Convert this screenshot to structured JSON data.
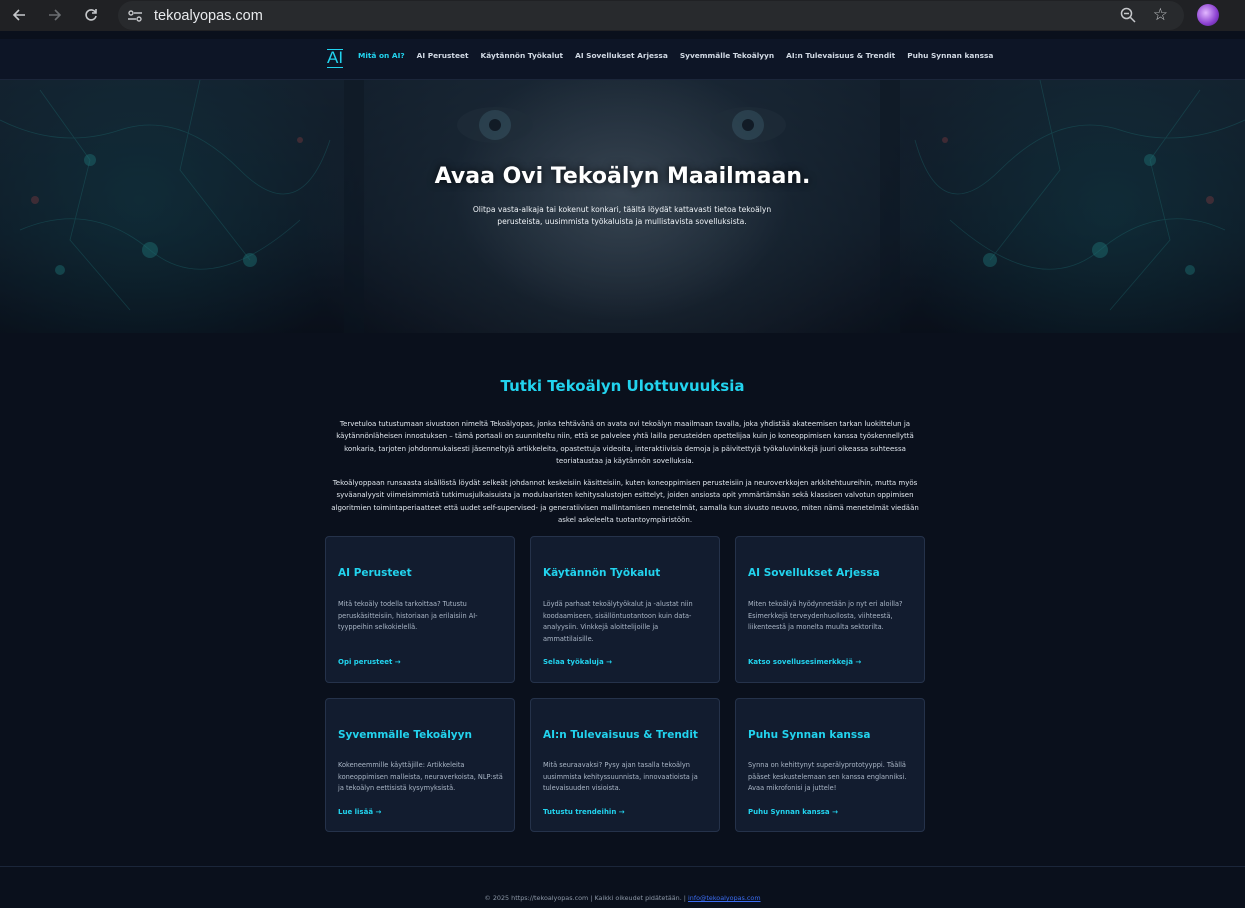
{
  "browser": {
    "url": "tekoalyopas.com"
  },
  "nav": {
    "logo": "AI",
    "links": [
      {
        "label": "Mitä on AI?",
        "active": true
      },
      {
        "label": "AI Perusteet"
      },
      {
        "label": "Käytännön Työkalut"
      },
      {
        "label": "AI Sovellukset Arjessa"
      },
      {
        "label": "Syvemmälle Tekoälyyn"
      },
      {
        "label": "AI:n Tulevaisuus & Trendit"
      },
      {
        "label": "Puhu Synnan kanssa"
      }
    ]
  },
  "hero": {
    "title": "Avaa Ovi Tekoälyn Maailmaan.",
    "subtitle": "Olitpa vasta-alkaja tai kokenut konkari, täältä löydät kattavasti tietoa tekoälyn perusteista, uusimmista työkaluista ja mullistavista sovelluksista."
  },
  "main": {
    "title": "Tutki Tekoälyn Ulottuvuuksia",
    "intro_1": "Tervetuloa tutustumaan sivustoon nimeltä Tekoälyopas, jonka tehtävänä on avata ovi tekoälyn maailmaan tavalla, joka yhdistää akateemisen tarkan luokittelun ja käytännönläheisen innostuksen – tämä portaali on suunniteltu niin, että se palvelee yhtä lailla perusteiden opettelijaa kuin jo koneoppimisen kanssa työskennellyttä konkaria, tarjoten johdonmukaisesti jäsenneltyjä artikkeleita, opastettuja videoita, interaktiivisia demoja ja päivitettyjä työkaluvinkkejä juuri oikeassa suhteessa teoriataustaa ja käytännön sovelluksia.",
    "intro_2": "Tekoälyoppaan runsaasta sisällöstä löydät selkeät johdannot keskeisiin käsitteisiin, kuten koneoppimisen perusteisiin ja neuroverkkojen arkkitehtuureihin, mutta myös syväanalyysit viimeisimmistä tutkimusjulkaisuista ja modulaaristen kehitysalustojen esittelyt, joiden ansiosta opit ymmärtämään sekä klassisen valvotun oppimisen algoritmien toimintaperiaatteet että uudet self-supervised- ja generatiivisen mallintamisen menetelmät, samalla kun sivusto neuvoo, miten nämä menetelmät viedään askel askeleelta tuotantoympäristöön."
  },
  "cards": [
    {
      "title": "AI Perusteet",
      "desc": "Mitä tekoäly todella tarkoittaa? Tutustu peruskäsitteisiin, historiaan ja erilaisiin AI-tyyppeihin selkokielellä.",
      "link": "Opi perusteet →"
    },
    {
      "title": "Käytännön Työkalut",
      "desc": "Löydä parhaat tekoälytyökalut ja -alustat niin koodaamiseen, sisällöntuotantoon kuin data-analyysiin. Vinkkejä aloittelijoille ja ammattilaisille.",
      "link": "Selaa työkaluja →"
    },
    {
      "title": "AI Sovellukset Arjessa",
      "desc": "Miten tekoälyä hyödynnetään jo nyt eri aloilla? Esimerkkejä terveydenhuollosta, viihteestä, liikenteestä ja monelta muulta sektorilta.",
      "link": "Katso sovellusesimerkkejä →"
    },
    {
      "title": "Syvemmälle Tekoälyyn",
      "desc": "Kokeneemmille käyttäjille: Artikkeleita koneoppimisen malleista, neuraverkoista, NLP:stä ja tekoälyn eettisistä kysymyksistä.",
      "link": "Lue lisää →"
    },
    {
      "title": "AI:n Tulevaisuus & Trendit",
      "desc": "Mitä seuraavaksi? Pysy ajan tasalla tekoälyn uusimmista kehityssuunnista, innovaatioista ja tulevaisuuden visioista.",
      "link": "Tutustu trendeihin →"
    },
    {
      "title": "Puhu Synnan kanssa",
      "desc": "Synna on kehittynyt superälyprototyyppi. Täällä pääset keskustelemaan sen kanssa englanniksi. Avaa mikrofonisi ja juttele!",
      "link": "Puhu Synnan kanssa →"
    }
  ],
  "footer": {
    "text": "© 2025 https://tekoalyopas.com | Kaikki oikeudet pidätetään. |",
    "email": "info@tekoalyopas.com"
  },
  "colors": {
    "accent": "#22d3ee",
    "background": "#0a101c",
    "card": "#121c2f"
  }
}
